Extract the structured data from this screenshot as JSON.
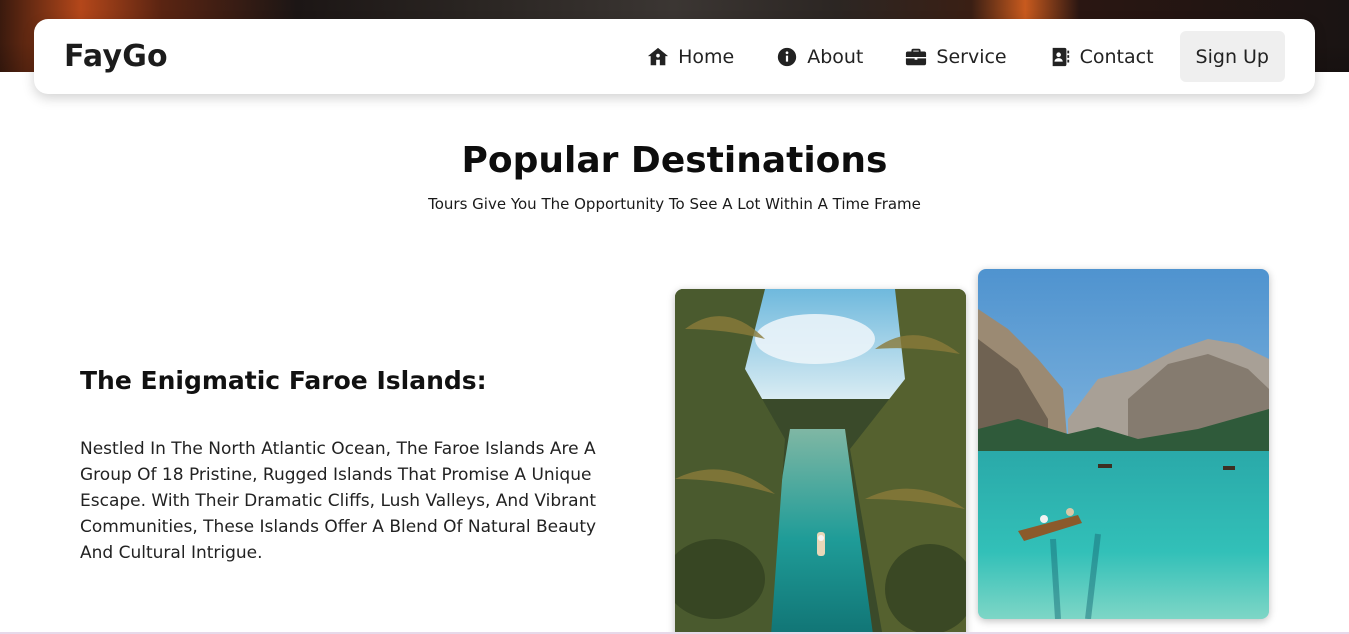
{
  "brand": {
    "name": "FayGo"
  },
  "nav": {
    "items": [
      {
        "label": "Home",
        "icon": "home-icon"
      },
      {
        "label": "About",
        "icon": "info-icon"
      },
      {
        "label": "Service",
        "icon": "briefcase-icon"
      },
      {
        "label": "Contact",
        "icon": "contact-book-icon"
      }
    ],
    "signup_label": "Sign Up"
  },
  "section": {
    "title": "Popular Destinations",
    "subtitle": "Tours Give You The Opportunity To See A Lot Within A Time Frame"
  },
  "destination": {
    "title": "The Enigmatic Faroe Islands:",
    "description": "Nestled In The North Atlantic Ocean, The Faroe Islands Are A Group Of 18 Pristine, Rugged Islands That Promise A Unique Escape. With Their Dramatic Cliffs, Lush Valleys, And Vibrant Communities, These Islands Offer A Blend Of Natural Beauty And Cultural Intrigue."
  },
  "colors": {
    "text": "#111111",
    "signup_bg": "#efefef",
    "water": "#2bb3b0"
  }
}
